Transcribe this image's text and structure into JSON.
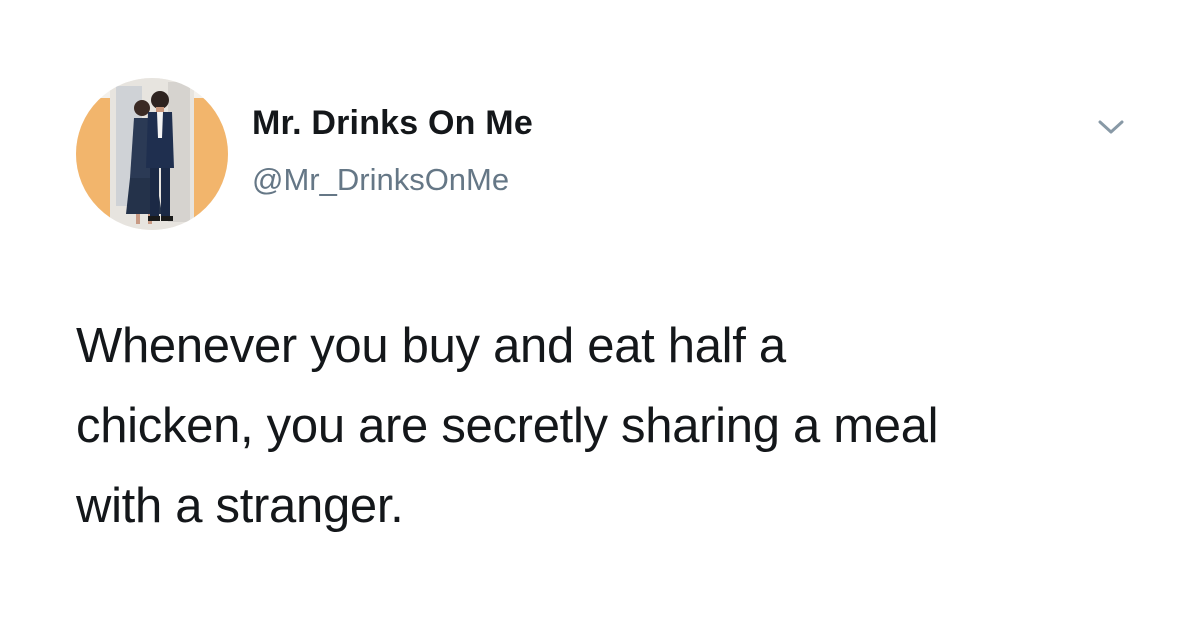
{
  "tweet": {
    "author": {
      "display_name": "Mr. Drinks On Me",
      "handle": "@Mr_DrinksOnMe",
      "avatar_icon": "profile-photo-couple"
    },
    "menu_icon": "chevron-down-icon",
    "text": "Whenever you buy and eat half a\nchicken, you are secretly sharing a meal\nwith a stranger."
  },
  "colors": {
    "background": "#ffffff",
    "name_text": "#14171a",
    "handle_text": "#657786",
    "caret": "#8899a6",
    "avatar_ring": "#f0b26a"
  }
}
